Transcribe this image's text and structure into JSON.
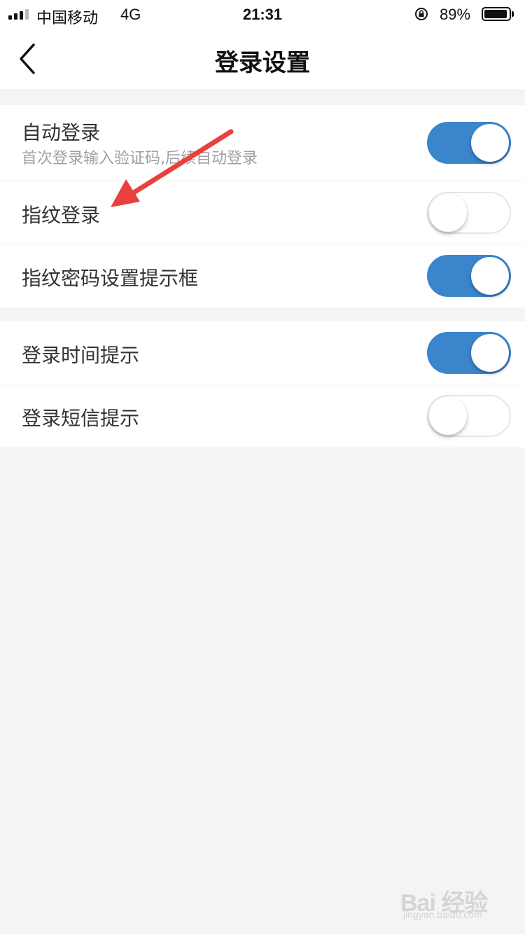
{
  "status_bar": {
    "carrier": "中国移动",
    "network": "4G",
    "time": "21:31",
    "battery_percent": "89%",
    "battery_level": 0.89,
    "icons": [
      "signal-icon",
      "orientation-lock-icon",
      "battery-icon"
    ]
  },
  "nav": {
    "title": "登录设置",
    "back_icon": "chevron-left-icon"
  },
  "settings": {
    "group1": [
      {
        "label": "自动登录",
        "sublabel": "首次登录输入验证码,后续自动登录",
        "on": true
      },
      {
        "label": "指纹登录",
        "on": false
      },
      {
        "label": "指纹密码设置提示框",
        "on": true
      }
    ],
    "group2": [
      {
        "label": "登录时间提示",
        "on": true
      },
      {
        "label": "登录短信提示",
        "on": false
      }
    ]
  },
  "colors": {
    "toggle_on": "#3a85cc",
    "background": "#f4f4f4",
    "annotation_arrow": "#e8413e"
  },
  "watermark": {
    "logo": "Bai 经验",
    "url": "jingyan.baidu.com"
  }
}
